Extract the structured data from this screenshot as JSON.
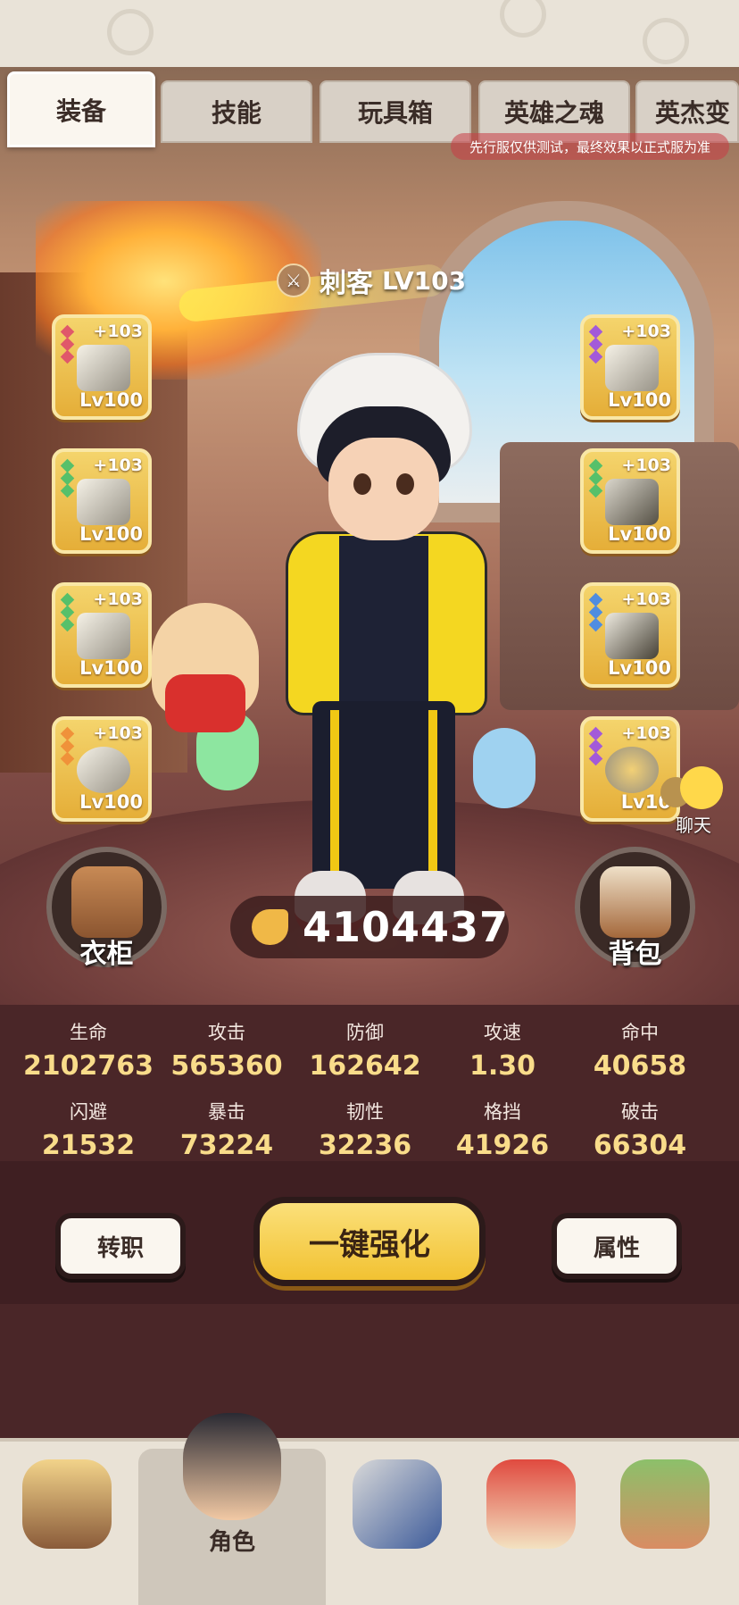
{
  "tabs": [
    {
      "label": "装备",
      "active": true
    },
    {
      "label": "技能"
    },
    {
      "label": "玩具箱"
    },
    {
      "label": "英雄之魂"
    },
    {
      "label": "英杰变"
    }
  ],
  "notice": "先行服仅供测试，最终效果以正式服为准",
  "character": {
    "class_name": "刺客",
    "level": "LV103"
  },
  "equipment_left": [
    {
      "plus": "+103",
      "level": "Lv100",
      "gem_color": "#e0586a",
      "icon": "dagger-icon"
    },
    {
      "plus": "+103",
      "level": "Lv100",
      "gem_color": "#57c06a",
      "icon": "blade-icon"
    },
    {
      "plus": "+103",
      "level": "Lv100",
      "gem_color": "#57c06a",
      "icon": "gauntlet-icon"
    },
    {
      "plus": "+103",
      "level": "Lv100",
      "gem_color": "#f0923a",
      "icon": "ring-icon"
    }
  ],
  "equipment_right": [
    {
      "plus": "+103",
      "level": "Lv100",
      "gem_color": "#a35ad8",
      "icon": "dagger-icon"
    },
    {
      "plus": "+103",
      "level": "Lv100",
      "gem_color": "#57c06a",
      "icon": "belt-icon"
    },
    {
      "plus": "+103",
      "level": "Lv100",
      "gem_color": "#4f8de0",
      "icon": "boots-icon"
    },
    {
      "plus": "+103",
      "level": "Lv10",
      "gem_color": "#a35ad8",
      "icon": "necklace-icon"
    }
  ],
  "wardrobe_label": "衣柜",
  "backpack_label": "背包",
  "power": "4104437",
  "chat_label": "聊天",
  "stats_row1": [
    {
      "key": "生命",
      "value": "2102763"
    },
    {
      "key": "攻击",
      "value": "565360"
    },
    {
      "key": "防御",
      "value": "162642"
    },
    {
      "key": "攻速",
      "value": "1.30"
    },
    {
      "key": "命中",
      "value": "40658"
    }
  ],
  "stats_row2": [
    {
      "key": "闪避",
      "value": "21532"
    },
    {
      "key": "暴击",
      "value": "73224"
    },
    {
      "key": "韧性",
      "value": "32236"
    },
    {
      "key": "格挡",
      "value": "41926"
    },
    {
      "key": "破击",
      "value": "66304"
    }
  ],
  "buttons": {
    "change_class": "转职",
    "enhance_all": "一键强化",
    "attributes": "属性"
  },
  "nav": [
    {
      "label": "",
      "icon": "tribe-mask-icon"
    },
    {
      "label": "角色",
      "icon": "hero-portrait-icon",
      "active": true
    },
    {
      "label": "",
      "icon": "weapon-shield-icon"
    },
    {
      "label": "",
      "icon": "dragon-pet-icon"
    },
    {
      "label": "",
      "icon": "totem-icon"
    }
  ],
  "colors": {
    "accent_gold": "#f2c232",
    "stat_value": "#f9dc8a",
    "background": "#4a2628"
  }
}
